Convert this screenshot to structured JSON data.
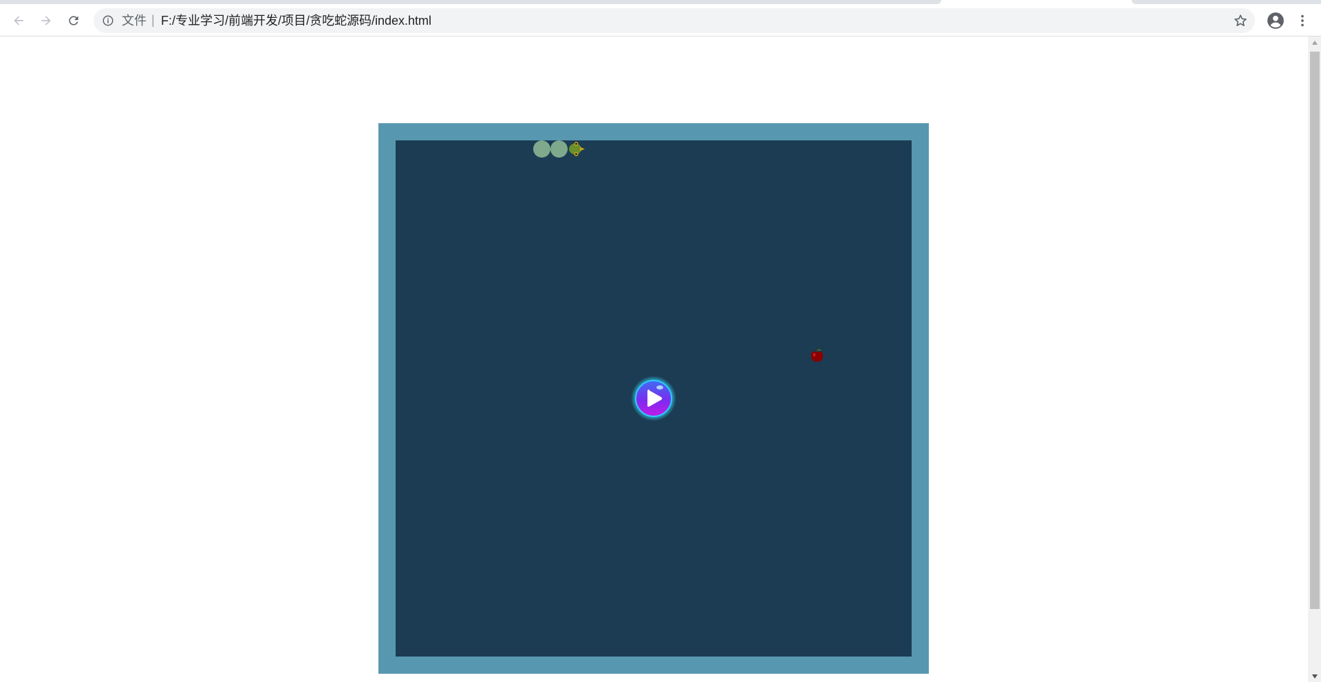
{
  "browser": {
    "address_scheme": "文件",
    "address_separator": "|",
    "address_url": "F:/专业学习/前端开发/项目/贪吃蛇源码/index.html",
    "icons": {
      "back": "back-arrow-icon",
      "forward": "forward-arrow-icon",
      "reload": "reload-icon",
      "info": "info-icon",
      "bookmark": "star-icon",
      "profile": "account-icon",
      "menu": "more-vert-icon"
    }
  },
  "game": {
    "colors": {
      "frame": "#5897b0",
      "board": "#1b3c53",
      "snake_body": "#7fa98c",
      "snake_head": "#6b8f2a",
      "apple": "#8b0000",
      "play_button": "#7b2cf0"
    },
    "snake_length": 3,
    "snake_direction": "right",
    "has_food": true,
    "state": "paused"
  }
}
